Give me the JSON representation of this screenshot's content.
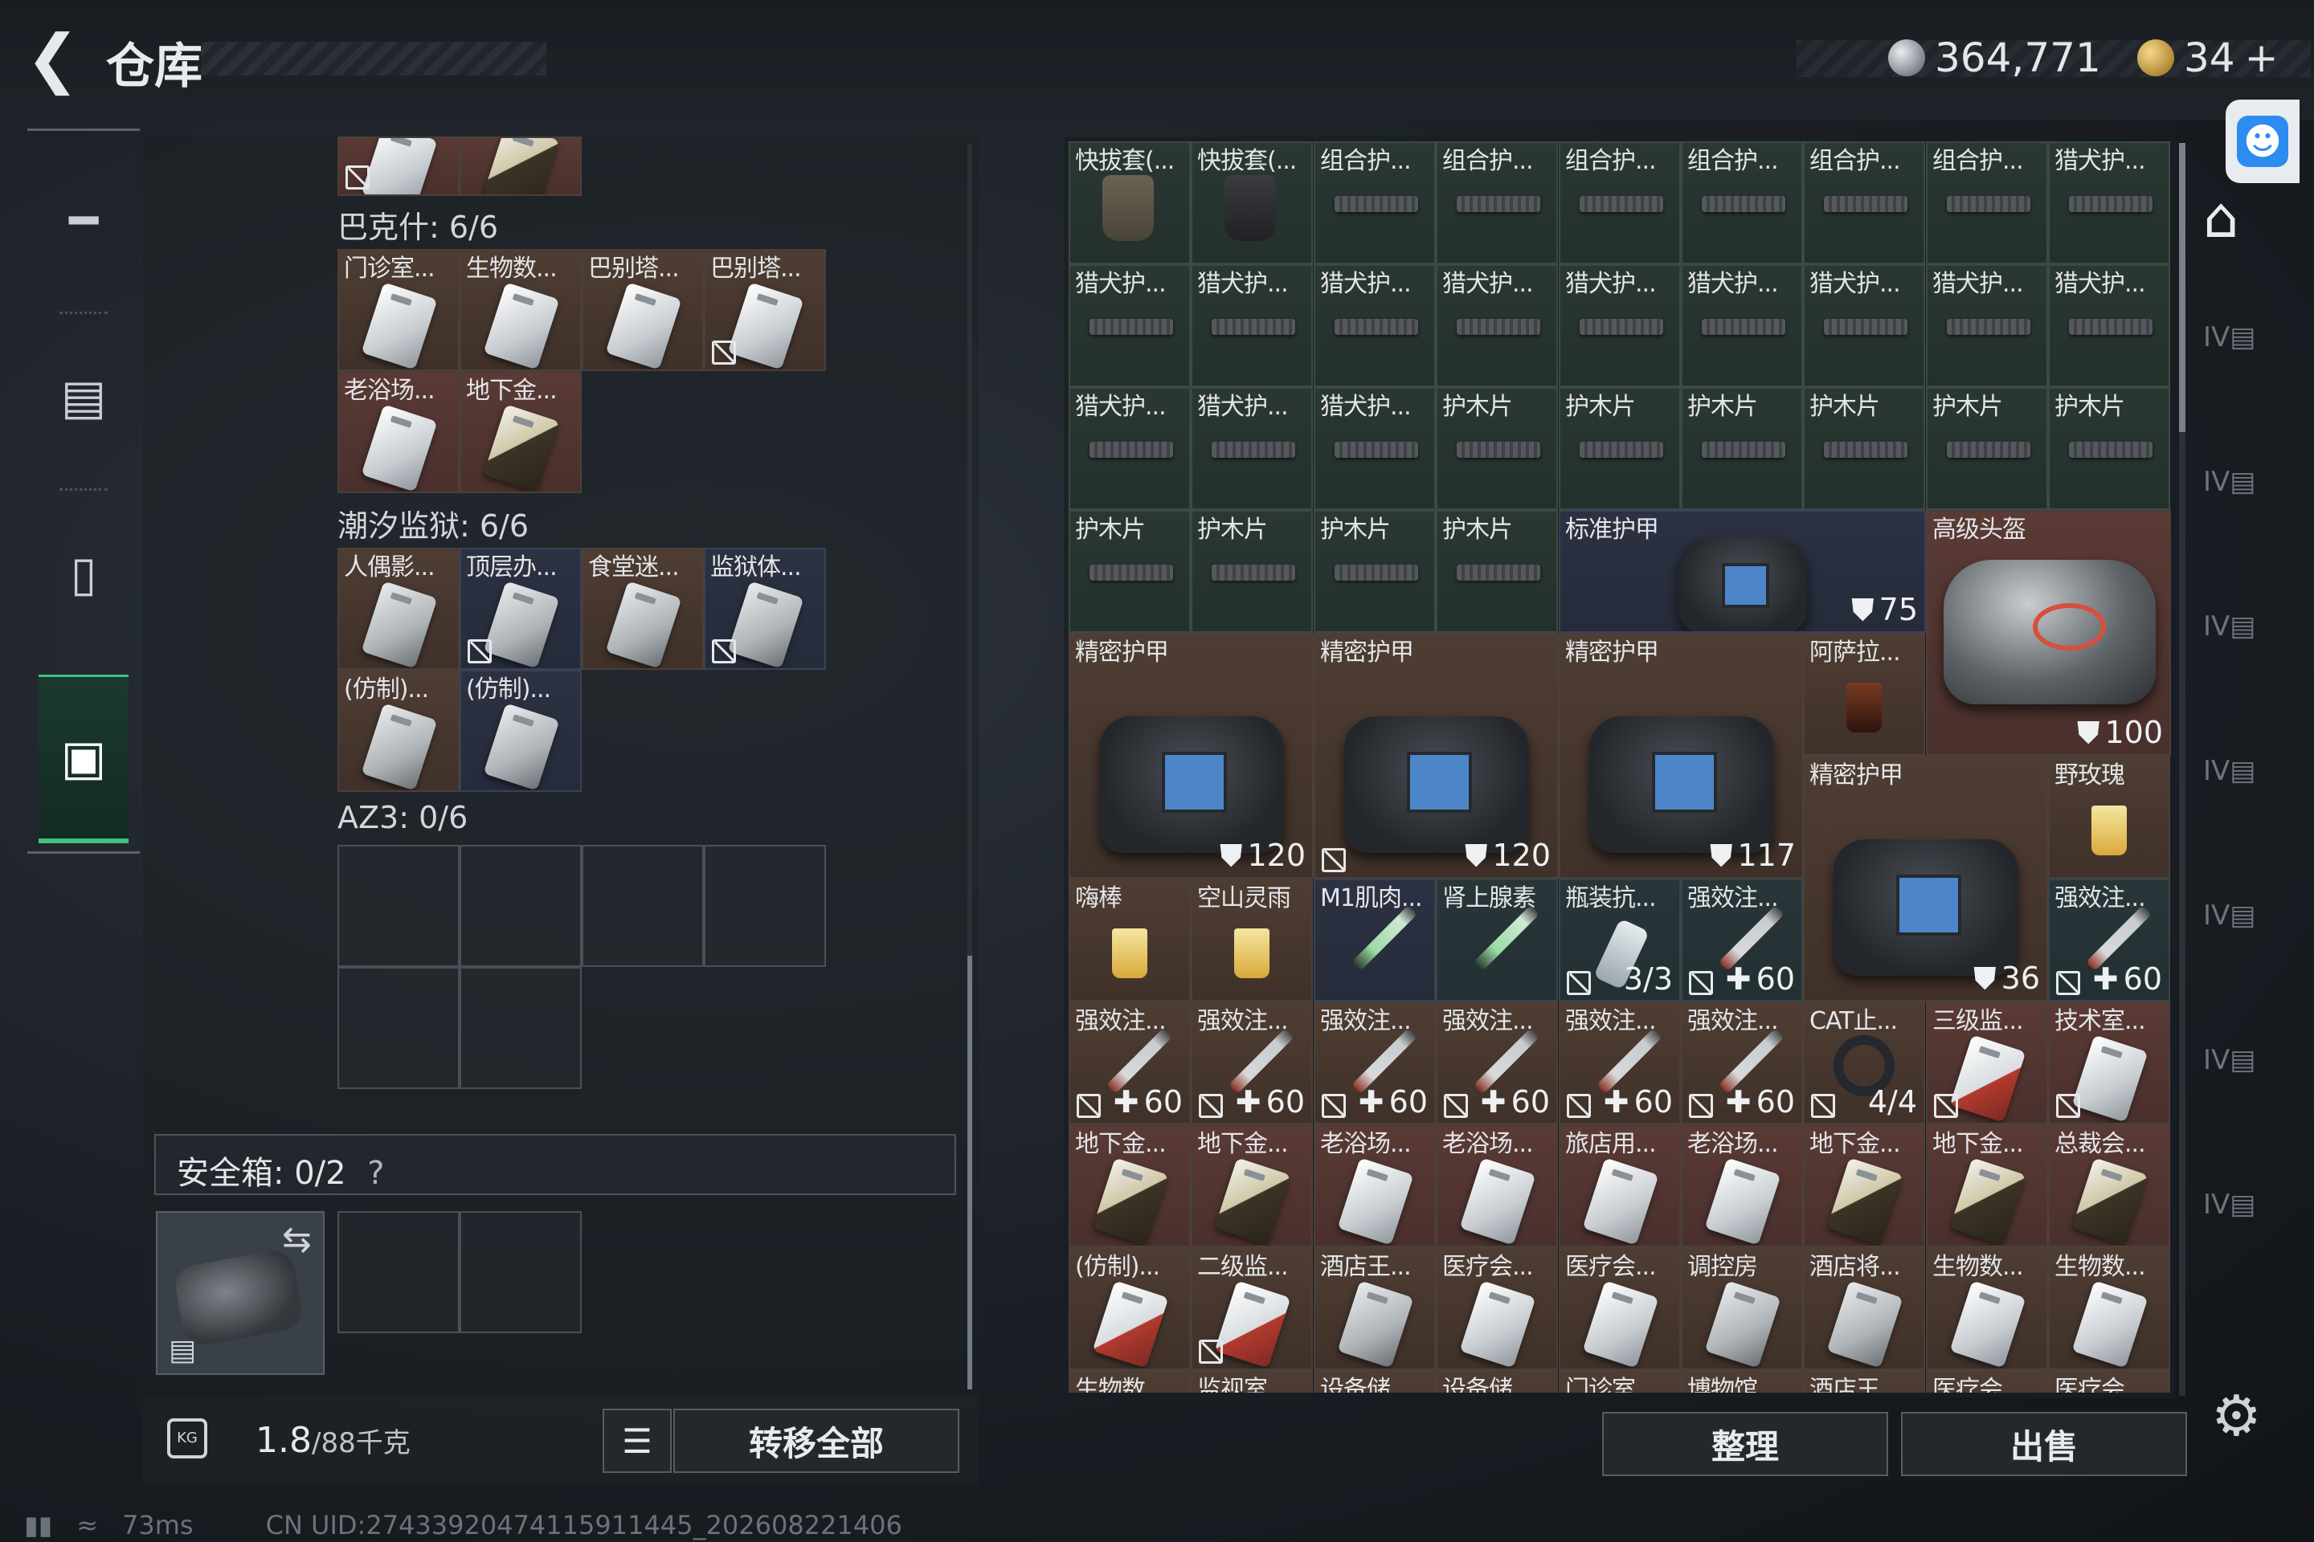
{
  "header": {
    "title": "仓库",
    "currency_silver": "364,771",
    "currency_gold": "34",
    "currency_plus": "+"
  },
  "left_nav": {
    "items": [
      "weapon-icon",
      "backpack-icon",
      "rig-icon",
      "case-icon"
    ]
  },
  "left_panel": {
    "sections": [
      {
        "label": "巴克什: 6/6"
      },
      {
        "label": "潮汐监狱: 6/6"
      },
      {
        "label": "AZ3: 0/6"
      }
    ],
    "bakshi": [
      {
        "name": "门诊室...",
        "style": "brown",
        "kind": "card"
      },
      {
        "name": "生物数...",
        "style": "brown",
        "kind": "card"
      },
      {
        "name": "巴别塔...",
        "style": "brown",
        "kind": "card"
      },
      {
        "name": "巴别塔...",
        "style": "brown",
        "kind": "card",
        "mark": true
      },
      {
        "name": "老浴场...",
        "style": "red",
        "kind": "card"
      },
      {
        "name": "地下金...",
        "style": "red",
        "kind": "card-gold"
      }
    ],
    "tide": [
      {
        "name": "人偶影...",
        "style": "brown",
        "kind": "tag"
      },
      {
        "name": "顶层办...",
        "style": "blue",
        "kind": "tag",
        "mark": true
      },
      {
        "name": "食堂迷...",
        "style": "brown",
        "kind": "tag"
      },
      {
        "name": "监狱体...",
        "style": "blue",
        "kind": "tag",
        "mark": true
      },
      {
        "name": "(仿制)...",
        "style": "brown",
        "kind": "tag"
      },
      {
        "name": "(仿制)...",
        "style": "blue",
        "kind": "tag"
      }
    ],
    "safe_box": {
      "label": "安全箱: 0/2",
      "help": "?"
    },
    "weight_value": "1.8",
    "weight_total": "/88千克",
    "transfer_all": "转移全部"
  },
  "right_panel": {
    "sort_button": "整理",
    "sell_button": "出售"
  },
  "status_bar": {
    "ping": "73ms",
    "uid": "CN UID:27433920474115911445_202608221406"
  },
  "grid_items": [
    {
      "c": 0,
      "r": 0,
      "w": 1,
      "h": 1,
      "name": "快拔套(...",
      "style": "green",
      "kind": "holster"
    },
    {
      "c": 1,
      "r": 0,
      "w": 1,
      "h": 1,
      "name": "快拔套(...",
      "style": "green",
      "kind": "holster-blk"
    },
    {
      "c": 2,
      "r": 0,
      "w": 1,
      "h": 1,
      "name": "组合护...",
      "style": "green",
      "kind": "strip"
    },
    {
      "c": 3,
      "r": 0,
      "w": 1,
      "h": 1,
      "name": "组合护...",
      "style": "green",
      "kind": "strip"
    },
    {
      "c": 4,
      "r": 0,
      "w": 1,
      "h": 1,
      "name": "组合护...",
      "style": "green",
      "kind": "strip"
    },
    {
      "c": 5,
      "r": 0,
      "w": 1,
      "h": 1,
      "name": "组合护...",
      "style": "green",
      "kind": "strip"
    },
    {
      "c": 6,
      "r": 0,
      "w": 1,
      "h": 1,
      "name": "组合护...",
      "style": "green",
      "kind": "strip"
    },
    {
      "c": 7,
      "r": 0,
      "w": 1,
      "h": 1,
      "name": "组合护...",
      "style": "green",
      "kind": "strip"
    },
    {
      "c": 8,
      "r": 0,
      "w": 1,
      "h": 1,
      "name": "猎犬护...",
      "style": "green",
      "kind": "strip"
    },
    {
      "c": 0,
      "r": 1,
      "w": 1,
      "h": 1,
      "name": "猎犬护...",
      "style": "green",
      "kind": "strip"
    },
    {
      "c": 1,
      "r": 1,
      "w": 1,
      "h": 1,
      "name": "猎犬护...",
      "style": "green",
      "kind": "strip"
    },
    {
      "c": 2,
      "r": 1,
      "w": 1,
      "h": 1,
      "name": "猎犬护...",
      "style": "green",
      "kind": "strip"
    },
    {
      "c": 3,
      "r": 1,
      "w": 1,
      "h": 1,
      "name": "猎犬护...",
      "style": "green",
      "kind": "strip"
    },
    {
      "c": 4,
      "r": 1,
      "w": 1,
      "h": 1,
      "name": "猎犬护...",
      "style": "green",
      "kind": "strip"
    },
    {
      "c": 5,
      "r": 1,
      "w": 1,
      "h": 1,
      "name": "猎犬护...",
      "style": "green",
      "kind": "strip"
    },
    {
      "c": 6,
      "r": 1,
      "w": 1,
      "h": 1,
      "name": "猎犬护...",
      "style": "green",
      "kind": "strip"
    },
    {
      "c": 7,
      "r": 1,
      "w": 1,
      "h": 1,
      "name": "猎犬护...",
      "style": "green",
      "kind": "strip"
    },
    {
      "c": 8,
      "r": 1,
      "w": 1,
      "h": 1,
      "name": "猎犬护...",
      "style": "green",
      "kind": "strip"
    },
    {
      "c": 0,
      "r": 2,
      "w": 1,
      "h": 1,
      "name": "猎犬护...",
      "style": "green",
      "kind": "strip"
    },
    {
      "c": 1,
      "r": 2,
      "w": 1,
      "h": 1,
      "name": "猎犬护...",
      "style": "green",
      "kind": "strip"
    },
    {
      "c": 2,
      "r": 2,
      "w": 1,
      "h": 1,
      "name": "猎犬护...",
      "style": "green",
      "kind": "strip"
    },
    {
      "c": 3,
      "r": 2,
      "w": 1,
      "h": 1,
      "name": "护木片",
      "style": "green",
      "kind": "strip"
    },
    {
      "c": 4,
      "r": 2,
      "w": 1,
      "h": 1,
      "name": "护木片",
      "style": "green",
      "kind": "strip"
    },
    {
      "c": 5,
      "r": 2,
      "w": 1,
      "h": 1,
      "name": "护木片",
      "style": "green",
      "kind": "strip"
    },
    {
      "c": 6,
      "r": 2,
      "w": 1,
      "h": 1,
      "name": "护木片",
      "style": "green",
      "kind": "strip"
    },
    {
      "c": 7,
      "r": 2,
      "w": 1,
      "h": 1,
      "name": "护木片",
      "style": "green",
      "kind": "strip"
    },
    {
      "c": 8,
      "r": 2,
      "w": 1,
      "h": 1,
      "name": "护木片",
      "style": "green",
      "kind": "strip"
    },
    {
      "c": 0,
      "r": 3,
      "w": 1,
      "h": 1,
      "name": "护木片",
      "style": "green",
      "kind": "strip"
    },
    {
      "c": 1,
      "r": 3,
      "w": 1,
      "h": 1,
      "name": "护木片",
      "style": "green",
      "kind": "strip"
    },
    {
      "c": 2,
      "r": 3,
      "w": 1,
      "h": 1,
      "name": "护木片",
      "style": "green",
      "kind": "strip"
    },
    {
      "c": 3,
      "r": 3,
      "w": 1,
      "h": 1,
      "name": "护木片",
      "style": "green",
      "kind": "strip"
    },
    {
      "c": 4,
      "r": 3,
      "w": 3,
      "h": 1,
      "name": "标准护甲",
      "style": "blue",
      "kind": "vest-small",
      "val": "75",
      "val_icon": "shield"
    },
    {
      "c": 7,
      "r": 3,
      "w": 2,
      "h": 2,
      "name": "高级头盔",
      "style": "red",
      "kind": "helmet",
      "val": "100",
      "val_icon": "shield"
    },
    {
      "c": 0,
      "r": 4,
      "w": 2,
      "h": 2,
      "name": "精密护甲",
      "style": "brown",
      "kind": "vest",
      "val": "120",
      "val_icon": "shield"
    },
    {
      "c": 2,
      "r": 4,
      "w": 2,
      "h": 2,
      "name": "精密护甲",
      "style": "brown",
      "kind": "vest",
      "val": "120",
      "val_icon": "shield",
      "mark": true
    },
    {
      "c": 4,
      "r": 4,
      "w": 2,
      "h": 2,
      "name": "精密护甲",
      "style": "brown",
      "kind": "vest",
      "val": "117",
      "val_icon": "shield"
    },
    {
      "c": 6,
      "r": 4,
      "w": 1,
      "h": 1,
      "name": "阿萨拉...",
      "style": "brown",
      "kind": "drink-dark"
    },
    {
      "c": 6,
      "r": 5,
      "w": 2,
      "h": 2,
      "name": "精密护甲",
      "style": "brown",
      "kind": "vest",
      "val": "36",
      "val_icon": "shield"
    },
    {
      "c": 8,
      "r": 5,
      "w": 1,
      "h": 1,
      "name": "野玫瑰",
      "style": "brown",
      "kind": "drink"
    },
    {
      "c": 0,
      "r": 6,
      "w": 1,
      "h": 1,
      "name": "嗨棒",
      "style": "brown",
      "kind": "drink"
    },
    {
      "c": 1,
      "r": 6,
      "w": 1,
      "h": 1,
      "name": "空山灵雨",
      "style": "brown",
      "kind": "drink"
    },
    {
      "c": 2,
      "r": 6,
      "w": 1,
      "h": 1,
      "name": "M1肌肉...",
      "style": "blue",
      "kind": "syringe-g"
    },
    {
      "c": 3,
      "r": 6,
      "w": 1,
      "h": 1,
      "name": "肾上腺素",
      "style": "teal",
      "kind": "syringe-g"
    },
    {
      "c": 4,
      "r": 6,
      "w": 1,
      "h": 1,
      "name": "瓶装抗...",
      "style": "teal",
      "kind": "bottle",
      "val": "3/3",
      "mark": true
    },
    {
      "c": 5,
      "r": 6,
      "w": 1,
      "h": 1,
      "name": "强效注...",
      "style": "teal",
      "kind": "syringe",
      "val": "60",
      "val_icon": "plus",
      "mark": true
    },
    {
      "c": 8,
      "r": 6,
      "w": 1,
      "h": 1,
      "name": "强效注...",
      "style": "teal",
      "kind": "syringe",
      "val": "60",
      "val_icon": "plus",
      "mark": true
    },
    {
      "c": 0,
      "r": 7,
      "w": 1,
      "h": 1,
      "name": "强效注...",
      "style": "brown",
      "kind": "syringe",
      "val": "60",
      "val_icon": "plus",
      "mark": true
    },
    {
      "c": 1,
      "r": 7,
      "w": 1,
      "h": 1,
      "name": "强效注...",
      "style": "brown",
      "kind": "syringe",
      "val": "60",
      "val_icon": "plus",
      "mark": true
    },
    {
      "c": 2,
      "r": 7,
      "w": 1,
      "h": 1,
      "name": "强效注...",
      "style": "brown",
      "kind": "syringe",
      "val": "60",
      "val_icon": "plus",
      "mark": true
    },
    {
      "c": 3,
      "r": 7,
      "w": 1,
      "h": 1,
      "name": "强效注...",
      "style": "brown",
      "kind": "syringe",
      "val": "60",
      "val_icon": "plus",
      "mark": true
    },
    {
      "c": 4,
      "r": 7,
      "w": 1,
      "h": 1,
      "name": "强效注...",
      "style": "brown",
      "kind": "syringe",
      "val": "60",
      "val_icon": "plus",
      "mark": true
    },
    {
      "c": 5,
      "r": 7,
      "w": 1,
      "h": 1,
      "name": "强效注...",
      "style": "brown",
      "kind": "syringe",
      "val": "60",
      "val_icon": "plus",
      "mark": true
    },
    {
      "c": 6,
      "r": 7,
      "w": 1,
      "h": 1,
      "name": "CAT止...",
      "style": "brown",
      "kind": "tourniquet",
      "val": "4/4",
      "mark": true
    },
    {
      "c": 7,
      "r": 7,
      "w": 1,
      "h": 1,
      "name": "三级监...",
      "style": "red",
      "kind": "card-red",
      "mark": true
    },
    {
      "c": 8,
      "r": 7,
      "w": 1,
      "h": 1,
      "name": "技术室...",
      "style": "red",
      "kind": "card",
      "mark": true
    },
    {
      "c": 0,
      "r": 8,
      "w": 1,
      "h": 1,
      "name": "地下金...",
      "style": "red",
      "kind": "card-gold"
    },
    {
      "c": 1,
      "r": 8,
      "w": 1,
      "h": 1,
      "name": "地下金...",
      "style": "red",
      "kind": "card-gold"
    },
    {
      "c": 2,
      "r": 8,
      "w": 1,
      "h": 1,
      "name": "老浴场...",
      "style": "red",
      "kind": "card"
    },
    {
      "c": 3,
      "r": 8,
      "w": 1,
      "h": 1,
      "name": "老浴场...",
      "style": "red",
      "kind": "card"
    },
    {
      "c": 4,
      "r": 8,
      "w": 1,
      "h": 1,
      "name": "旅店用...",
      "style": "red",
      "kind": "card"
    },
    {
      "c": 5,
      "r": 8,
      "w": 1,
      "h": 1,
      "name": "老浴场...",
      "style": "red",
      "kind": "card"
    },
    {
      "c": 6,
      "r": 8,
      "w": 1,
      "h": 1,
      "name": "地下金...",
      "style": "red",
      "kind": "card-gold"
    },
    {
      "c": 7,
      "r": 8,
      "w": 1,
      "h": 1,
      "name": "地下金...",
      "style": "red",
      "kind": "card-gold"
    },
    {
      "c": 8,
      "r": 8,
      "w": 1,
      "h": 1,
      "name": "总裁会...",
      "style": "red",
      "kind": "card-gold"
    },
    {
      "c": 0,
      "r": 9,
      "w": 1,
      "h": 1,
      "name": "(仿制)...",
      "style": "brown",
      "kind": "card-red"
    },
    {
      "c": 1,
      "r": 9,
      "w": 1,
      "h": 1,
      "name": "二级监...",
      "style": "brown",
      "kind": "card-red",
      "mark": true
    },
    {
      "c": 2,
      "r": 9,
      "w": 1,
      "h": 1,
      "name": "酒店王...",
      "style": "brown",
      "kind": "tag"
    },
    {
      "c": 3,
      "r": 9,
      "w": 1,
      "h": 1,
      "name": "医疗会...",
      "style": "brown",
      "kind": "card"
    },
    {
      "c": 4,
      "r": 9,
      "w": 1,
      "h": 1,
      "name": "医疗会...",
      "style": "brown",
      "kind": "card"
    },
    {
      "c": 5,
      "r": 9,
      "w": 1,
      "h": 1,
      "name": "调控房",
      "style": "brown",
      "kind": "tag"
    },
    {
      "c": 6,
      "r": 9,
      "w": 1,
      "h": 1,
      "name": "酒店将...",
      "style": "brown",
      "kind": "tag"
    },
    {
      "c": 7,
      "r": 9,
      "w": 1,
      "h": 1,
      "name": "生物数...",
      "style": "brown",
      "kind": "card"
    },
    {
      "c": 8,
      "r": 9,
      "w": 1,
      "h": 1,
      "name": "生物数...",
      "style": "brown",
      "kind": "card"
    },
    {
      "c": 0,
      "r": 10,
      "w": 1,
      "h": 1,
      "name": "生物数...",
      "style": "brown",
      "kind": "card"
    },
    {
      "c": 1,
      "r": 10,
      "w": 1,
      "h": 1,
      "name": "监视室...",
      "style": "brown",
      "kind": "card"
    },
    {
      "c": 2,
      "r": 10,
      "w": 1,
      "h": 1,
      "name": "设备储...",
      "style": "brown",
      "kind": "card"
    },
    {
      "c": 3,
      "r": 10,
      "w": 1,
      "h": 1,
      "name": "设备储...",
      "style": "brown",
      "kind": "card"
    },
    {
      "c": 4,
      "r": 10,
      "w": 1,
      "h": 1,
      "name": "门诊室...",
      "style": "brown",
      "kind": "card"
    },
    {
      "c": 5,
      "r": 10,
      "w": 1,
      "h": 1,
      "name": "博物馆...",
      "style": "brown",
      "kind": "card"
    },
    {
      "c": 6,
      "r": 10,
      "w": 1,
      "h": 1,
      "name": "酒店王...",
      "style": "brown",
      "kind": "card"
    },
    {
      "c": 7,
      "r": 10,
      "w": 1,
      "h": 1,
      "name": "医疗会...",
      "style": "brown",
      "kind": "card"
    },
    {
      "c": 8,
      "r": 10,
      "w": 1,
      "h": 1,
      "name": "医疗会...",
      "style": "brown",
      "kind": "card"
    }
  ]
}
